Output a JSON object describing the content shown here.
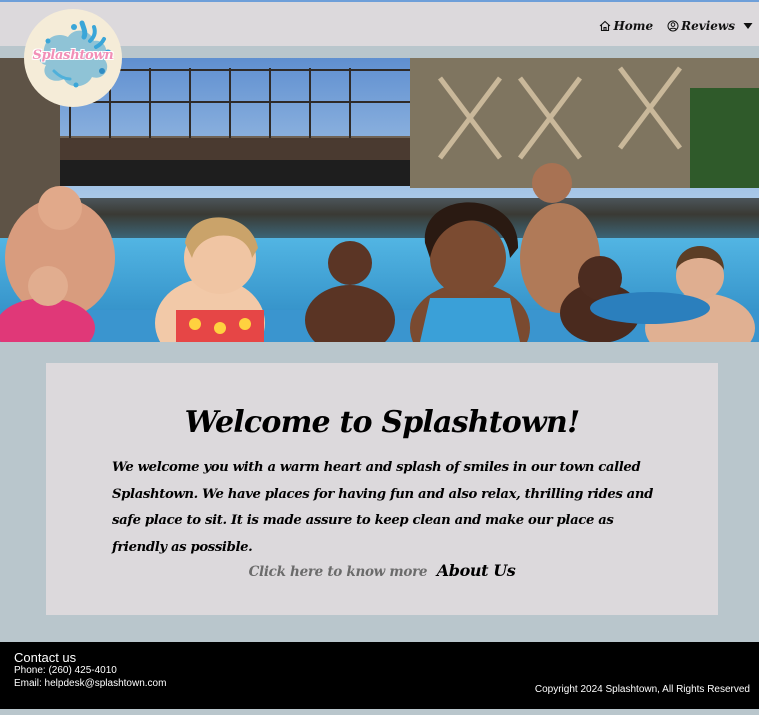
{
  "brand": {
    "logo_text": "Splashtown"
  },
  "nav": {
    "home_label": "Home",
    "reviews_label": "Reviews"
  },
  "hero": {
    "alt": "Family enjoying the water park pool"
  },
  "welcome": {
    "title": "Welcome to Splashtown!",
    "body": "We welcome you with a warm heart and splash of smiles in our town called Splashtown. We have places for having fun and also relax, thrilling rides and safe place to sit. It is made assure to keep clean and make our place as friendly as possible.",
    "cta_prefix": "Click here to know more",
    "cta_link": "About Us"
  },
  "footer": {
    "title": "Contact us",
    "phone": "Phone: (260) 425-4010",
    "email": "Email: helpdesk@splashtown.com",
    "copyright": "Copyright 2024 Splashtown, All Rights Reserved"
  },
  "colors": {
    "header_bg": "#dcd9dc",
    "page_bg": "#b9c6cc",
    "card_bg": "#dcd9dc",
    "footer_bg": "#000000",
    "logo_pink": "#f28fb7",
    "logo_blue": "#3aa6d8"
  },
  "icons": {
    "home": "home-icon",
    "reviews": "user-circle-icon",
    "dropdown": "caret-down-icon"
  }
}
